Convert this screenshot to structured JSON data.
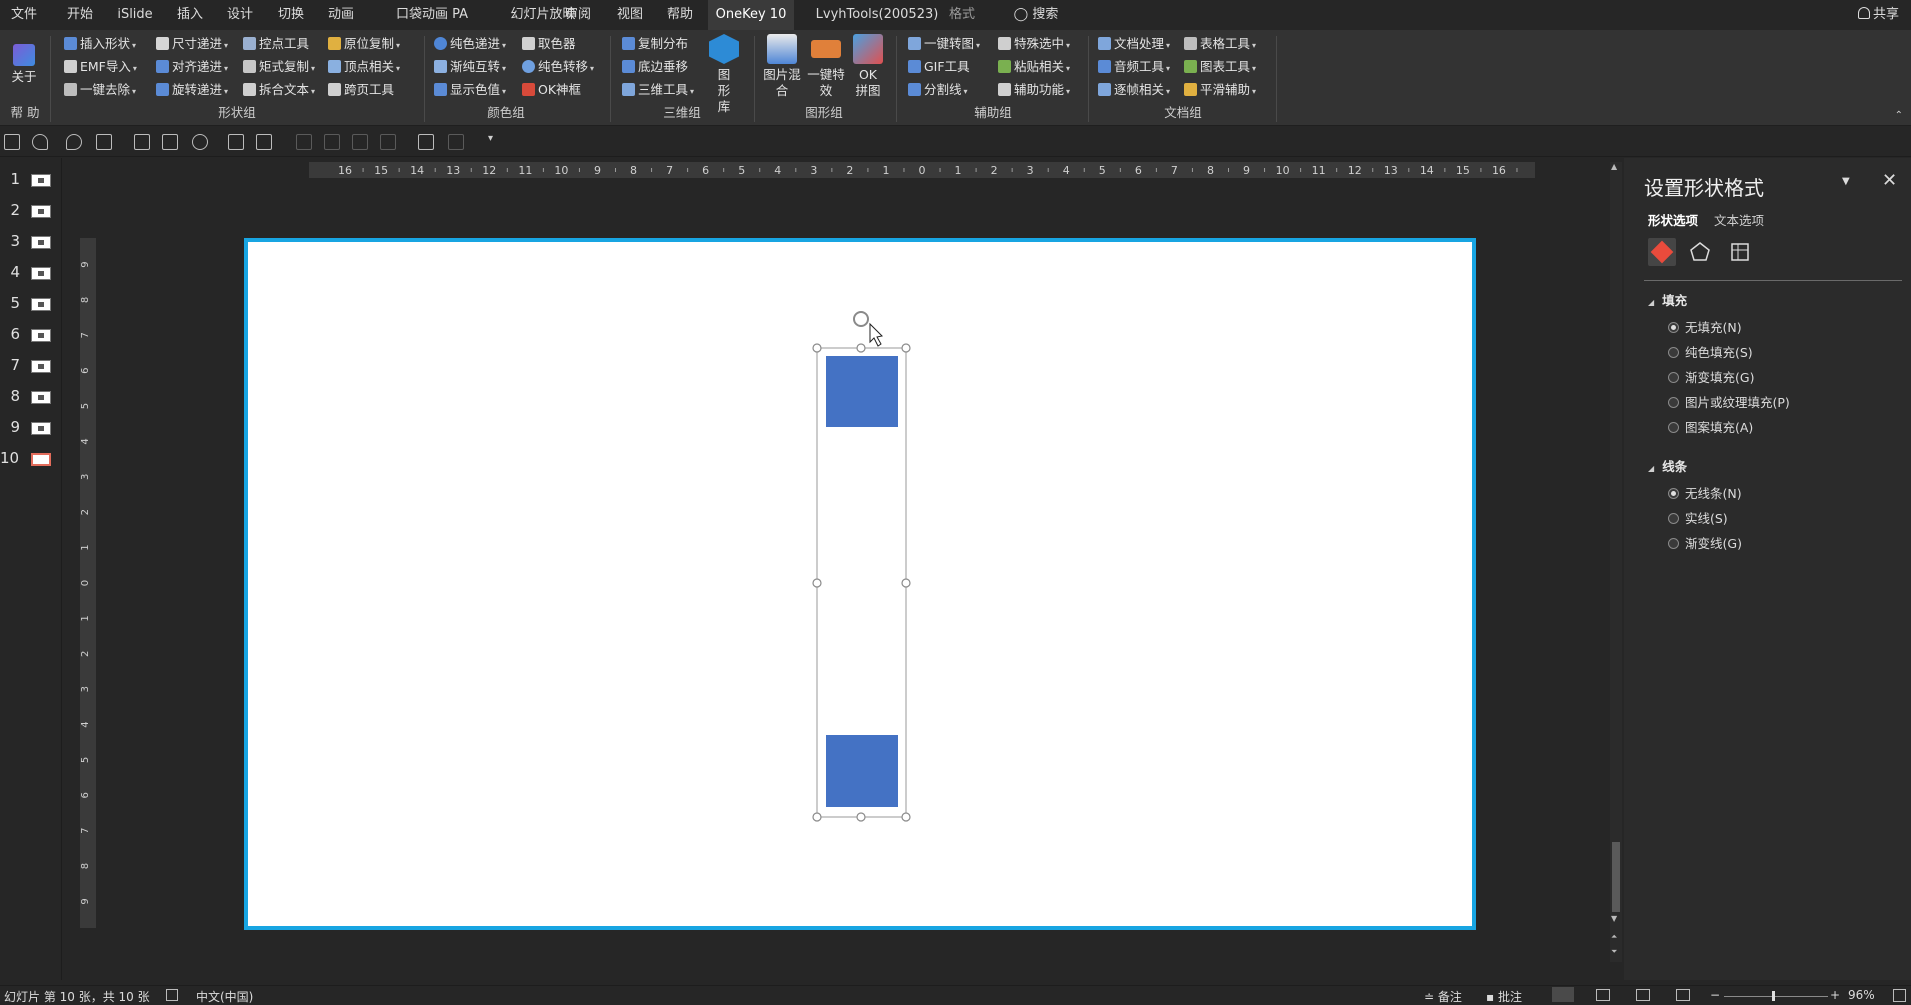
{
  "menu": {
    "tabs": [
      "文件",
      "开始",
      "iSlide",
      "插入",
      "设计",
      "切换",
      "动画",
      "口袋动画 PA",
      "幻灯片放映",
      "审阅",
      "视图",
      "帮助",
      "OneKey 10",
      "LvyhTools(200523)",
      "格式"
    ],
    "active_tab": "OneKey 10",
    "search": "搜索",
    "share": "共享"
  },
  "ribbon": {
    "help_group": {
      "about_label": "关于",
      "group_label": "帮 助"
    },
    "shape_group": {
      "label": "形状组",
      "buttons": [
        "插入形状",
        "尺寸递进",
        "控点工具",
        "原位复制",
        "EMF导入",
        "对齐递进",
        "矩式复制",
        "顶点相关",
        "一键去除",
        "旋转递进",
        "拆合文本",
        "跨页工具"
      ]
    },
    "color_group": {
      "label": "颜色组",
      "buttons": [
        "纯色递进",
        "取色器",
        "渐纯互转",
        "纯色转移",
        "显示色值",
        "OK神框"
      ]
    },
    "3d_group": {
      "label": "三维组",
      "buttons": [
        "复制分布",
        "底边垂移",
        "三维工具"
      ],
      "big_button": "图形库"
    },
    "image_group": {
      "label": "图形组",
      "big_buttons": [
        "图片混合",
        "一键特效",
        "OK拼图"
      ]
    },
    "assist_group": {
      "label": "辅助组",
      "buttons": [
        "一键转图",
        "特殊选中",
        "GIF工具",
        "粘贴相关",
        "分割线",
        "辅助功能"
      ]
    },
    "doc_group": {
      "label": "文档组",
      "buttons": [
        "文档处理",
        "表格工具",
        "音频工具",
        "图表工具",
        "逐帧相关",
        "平滑辅助"
      ]
    }
  },
  "slides": {
    "numbers": [
      "1",
      "2",
      "3",
      "4",
      "5",
      "6",
      "7",
      "8",
      "9",
      "10"
    ],
    "active": "10"
  },
  "ruler": {
    "horizontal": [
      "16",
      "15",
      "14",
      "13",
      "12",
      "11",
      "10",
      "9",
      "8",
      "7",
      "6",
      "5",
      "4",
      "3",
      "2",
      "1",
      "0",
      "1",
      "2",
      "3",
      "4",
      "5",
      "6",
      "7",
      "8",
      "9",
      "10",
      "11",
      "12",
      "13",
      "14",
      "15",
      "16"
    ],
    "vertical": [
      "9",
      "8",
      "7",
      "6",
      "5",
      "4",
      "3",
      "2",
      "1",
      "0",
      "1",
      "2",
      "3",
      "4",
      "5",
      "6",
      "7",
      "8",
      "9"
    ]
  },
  "shape_color": "#4472C4",
  "selection_color": "#18A5E2",
  "format_pane": {
    "title": "设置形状格式",
    "tabs": [
      "形状选项",
      "文本选项"
    ],
    "fill": {
      "header": "填充",
      "options": [
        "无填充(N)",
        "纯色填充(S)",
        "渐变填充(G)",
        "图片或纹理填充(P)",
        "图案填充(A)"
      ],
      "selected": "无填充(N)"
    },
    "line": {
      "header": "线条",
      "options": [
        "无线条(N)",
        "实线(S)",
        "渐变线(G)"
      ],
      "selected": "无线条(N)"
    }
  },
  "status": {
    "slide_info": "幻灯片 第 10 张，共 10 张",
    "language": "中文(中国)",
    "notes": "备注",
    "comments": "批注",
    "zoom": "96%"
  }
}
